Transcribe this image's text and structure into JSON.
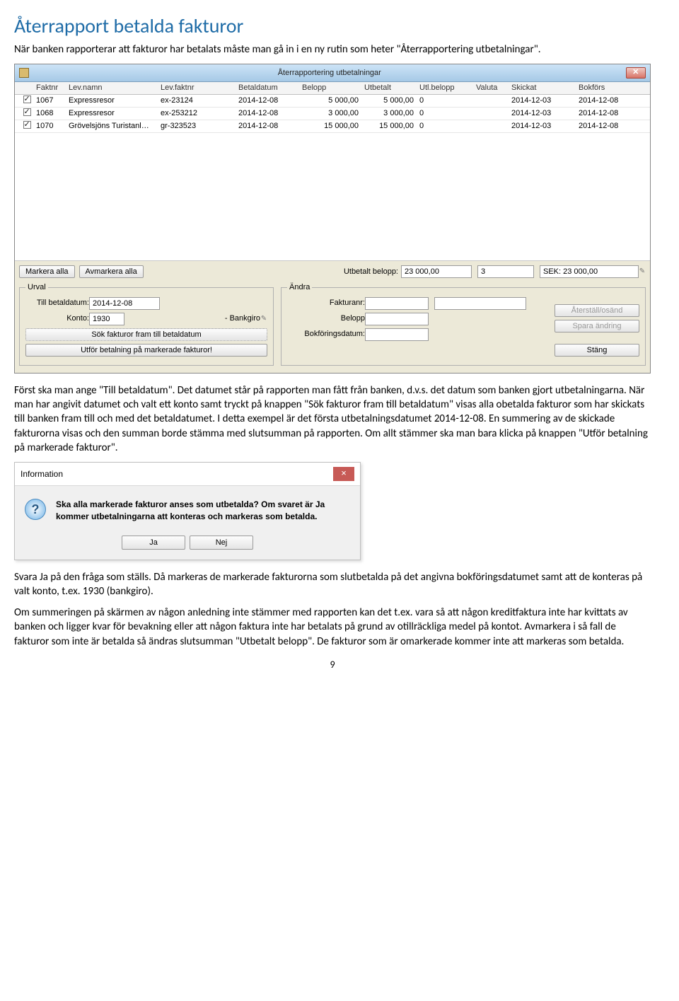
{
  "heading": "Återrapport betalda fakturor",
  "intro": "När banken rapporterar att fakturor har betalats måste man gå in i en ny rutin som heter \"Återrapportering utbetalningar\".",
  "window": {
    "title": "Återrapportering utbetalningar",
    "headers": {
      "faktnr": "Faktnr",
      "levnamn": "Lev.namn",
      "levfaktnr": "Lev.faktnr",
      "betaldatum": "Betaldatum",
      "belopp": "Belopp",
      "utbetalt": "Utbetalt",
      "utlbelopp": "Utl.belopp",
      "valuta": "Valuta",
      "skickat": "Skickat",
      "bokfors": "Bokförs"
    },
    "rows": [
      {
        "checked": true,
        "faktnr": "1067",
        "lev": "Expressresor",
        "levfaktnr": "ex-23124",
        "betaldatum": "2014-12-08",
        "belopp": "5 000,00",
        "utbetalt": "5 000,00",
        "utlbelopp": "0",
        "valuta": "",
        "skickat": "2014-12-03",
        "bokfors": "2014-12-08"
      },
      {
        "checked": true,
        "faktnr": "1068",
        "lev": "Expressresor",
        "levfaktnr": "ex-253212",
        "betaldatum": "2014-12-08",
        "belopp": "3 000,00",
        "utbetalt": "3 000,00",
        "utlbelopp": "0",
        "valuta": "",
        "skickat": "2014-12-03",
        "bokfors": "2014-12-08"
      },
      {
        "checked": true,
        "faktnr": "1070",
        "lev": "Grövelsjöns Turistanl…",
        "levfaktnr": "gr-323523",
        "betaldatum": "2014-12-08",
        "belopp": "15 000,00",
        "utbetalt": "15 000,00",
        "utlbelopp": "0",
        "valuta": "",
        "skickat": "2014-12-03",
        "bokfors": "2014-12-08"
      }
    ],
    "buttons": {
      "markera": "Markera alla",
      "avmarkera": "Avmarkera alla",
      "sok": "Sök fakturor fram till betaldatum",
      "utfor": "Utför betalning på markerade fakturor!",
      "aterstall": "Återställ/osänd",
      "spara": "Spara ändring",
      "stang": "Stäng"
    },
    "labels": {
      "utbetalt_belopp": "Utbetalt belopp:",
      "urval": "Urval",
      "andra": "Ändra",
      "till_betaldatum": "Till betaldatum:",
      "konto": "Konto:",
      "konto_text": "- Bankgiro",
      "fakturanr": "Fakturanr:",
      "belopp": "Belopp",
      "bokforingsdatum": "Bokföringsdatum:"
    },
    "values": {
      "utbetalt_belopp": "23 000,00",
      "count": "3",
      "sek": "SEK: 23 000,00",
      "till_betaldatum": "2014-12-08",
      "konto": "1930"
    }
  },
  "paragraph2": "Först ska man ange \"Till betaldatum\". Det datumet står på rapporten man fått från banken, d.v.s. det datum som banken gjort utbetalningarna. När man har angivit datumet och valt ett konto samt tryckt på knappen \"Sök fakturor fram till betaldatum\" visas alla obetalda fakturor som har skickats till banken fram till och med det betaldatumet. I detta exempel är det första utbetalningsdatumet 2014-12-08. En summering av de skickade fakturorna visas och den summan borde stämma med slutsumman på rapporten. Om allt stämmer ska man bara klicka på knappen \"Utför betalning på markerade fakturor\".",
  "dialog": {
    "title": "Information",
    "message": "Ska alla markerade fakturor anses som utbetalda? Om svaret är Ja kommer utbetalningarna att konteras och markeras som betalda.",
    "yes": "Ja",
    "no": "Nej"
  },
  "paragraph3": "Svara Ja på den fråga som ställs. Då markeras de markerade fakturorna som slutbetalda på det angivna bokföringsdatumet samt att de konteras på valt konto, t.ex. 1930 (bankgiro).",
  "paragraph4": "Om summeringen på skärmen av någon anledning inte stämmer med rapporten kan det t.ex. vara så att någon kreditfaktura inte har kvittats av banken och ligger kvar för bevakning eller att någon faktura inte har betalats på grund av otillräckliga medel på kontot. Avmarkera i så fall de fakturor som inte är betalda så ändras slutsumman \"Utbetalt belopp\". De fakturor som är omarkerade kommer inte att markeras som betalda.",
  "pagenum": "9"
}
